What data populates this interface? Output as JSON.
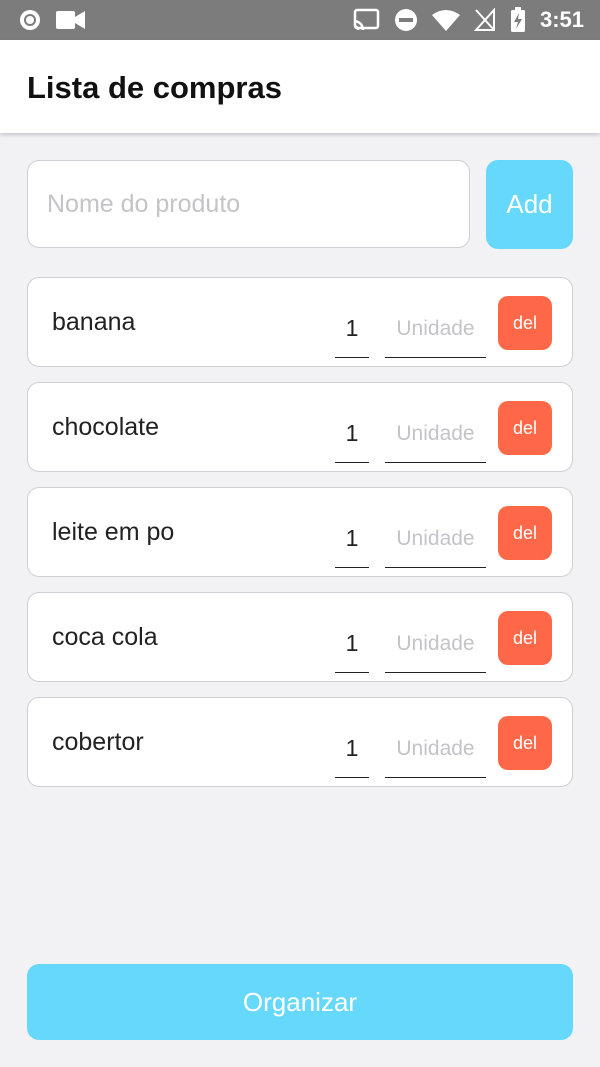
{
  "status_bar": {
    "time": "3:51",
    "icons": [
      "record-icon",
      "video-camera-icon",
      "cast-icon",
      "do-not-disturb-icon",
      "wifi-icon",
      "no-signal-icon",
      "battery-charging-icon"
    ]
  },
  "app_bar": {
    "title": "Lista de compras"
  },
  "add_form": {
    "name_placeholder": "Nome do produto",
    "name_value": "",
    "add_label": "Add"
  },
  "items": [
    {
      "name": "banana",
      "quantity": "1",
      "unit_placeholder": "Unidade",
      "delete_label": "del"
    },
    {
      "name": "chocolate",
      "quantity": "1",
      "unit_placeholder": "Unidade",
      "delete_label": "del"
    },
    {
      "name": "leite em po",
      "quantity": "1",
      "unit_placeholder": "Unidade",
      "delete_label": "del"
    },
    {
      "name": "coca cola",
      "quantity": "1",
      "unit_placeholder": "Unidade",
      "delete_label": "del"
    },
    {
      "name": "cobertor",
      "quantity": "1",
      "unit_placeholder": "Unidade",
      "delete_label": "del"
    }
  ],
  "footer": {
    "organize_label": "Organizar"
  },
  "colors": {
    "accent": "#65d8fb",
    "delete": "#fe6849",
    "status_bar": "#7c7c7c",
    "background": "#f2f2f4"
  }
}
